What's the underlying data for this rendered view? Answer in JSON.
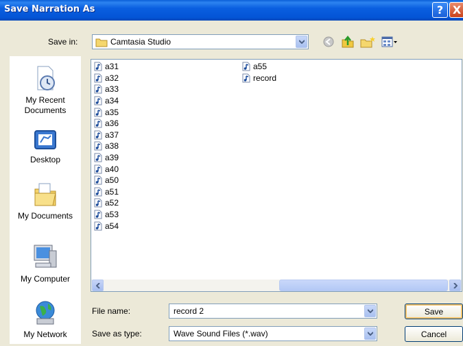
{
  "window": {
    "title": "Save Narration As",
    "help_label": "?",
    "close_label": "X"
  },
  "save_in": {
    "label": "Save in:",
    "value": "Camtasia Studio"
  },
  "places": [
    {
      "label": "My Recent Documents",
      "icon": "recent-documents-icon"
    },
    {
      "label": "Desktop",
      "icon": "desktop-icon"
    },
    {
      "label": "My Documents",
      "icon": "my-documents-icon"
    },
    {
      "label": "My Computer",
      "icon": "my-computer-icon"
    },
    {
      "label": "My Network",
      "icon": "my-network-icon"
    }
  ],
  "files": {
    "column1": [
      "a31",
      "a32",
      "a33",
      "a34",
      "a35",
      "a36",
      "a37",
      "a38",
      "a39",
      "a40",
      "a50",
      "a51",
      "a52",
      "a53",
      "a54"
    ],
    "column2": [
      "a55",
      "record"
    ]
  },
  "file_name": {
    "label": "File name:",
    "value": "record 2"
  },
  "save_as_type": {
    "label": "Save as type:",
    "value": "Wave Sound Files (*.wav)"
  },
  "buttons": {
    "save": "Save",
    "cancel": "Cancel"
  },
  "colors": {
    "titlebar": "#0454d6",
    "dialog_bg": "#ece9d8",
    "field_border": "#7f9db9"
  }
}
